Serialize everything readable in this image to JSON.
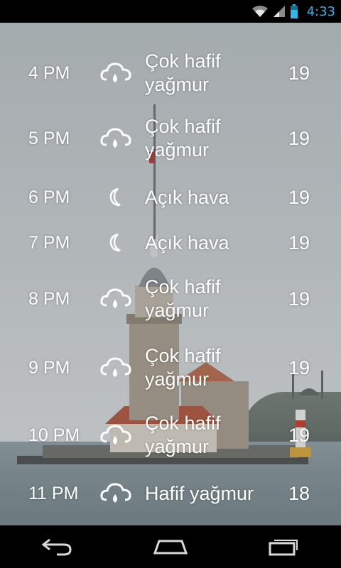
{
  "status_bar": {
    "time": "4:33",
    "icons": [
      "wifi-icon",
      "signal-icon",
      "battery-icon"
    ]
  },
  "background": {
    "subject": "Maiden's Tower"
  },
  "forecast": [
    {
      "hour": "4 PM",
      "icon": "rain-cloud-icon",
      "condition": "Çok hafif yağmur",
      "temp": "19"
    },
    {
      "hour": "5 PM",
      "icon": "rain-cloud-icon",
      "condition": "Çok hafif yağmur",
      "temp": "19"
    },
    {
      "hour": "6 PM",
      "icon": "moon-icon",
      "condition": "Açık hava",
      "temp": "19"
    },
    {
      "hour": "7 PM",
      "icon": "moon-icon",
      "condition": "Açık hava",
      "temp": "19"
    },
    {
      "hour": "8 PM",
      "icon": "rain-cloud-icon",
      "condition": "Çok hafif yağmur",
      "temp": "19"
    },
    {
      "hour": "9 PM",
      "icon": "rain-cloud-icon",
      "condition": "Çok hafif yağmur",
      "temp": "19"
    },
    {
      "hour": "10 PM",
      "icon": "rain-cloud-icon",
      "condition": "Çok hafif yağmur",
      "temp": "19"
    },
    {
      "hour": "11 PM",
      "icon": "rain-cloud-icon",
      "condition": "Hafif yağmur",
      "temp": "18"
    }
  ],
  "nav_bar": {
    "buttons": [
      "back-icon",
      "home-icon",
      "recent-apps-icon"
    ]
  },
  "colors": {
    "text": "#ffffff",
    "clock": "#33b5e5",
    "bar": "#000000"
  }
}
